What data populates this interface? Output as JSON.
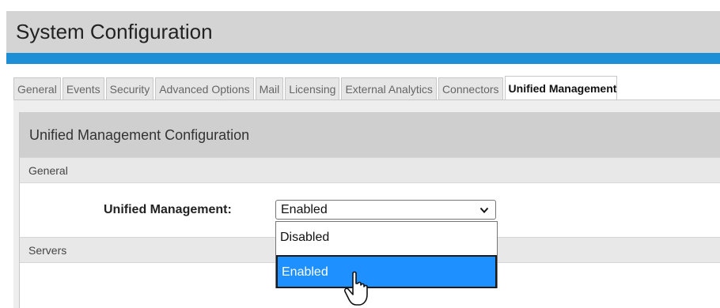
{
  "page": {
    "title": "System Configuration"
  },
  "tabs": [
    "General",
    "Events",
    "Security",
    "Advanced Options",
    "Mail",
    "Licensing",
    "External Analytics",
    "Connectors",
    "Unified Management"
  ],
  "active_tab": "Unified Management",
  "panel": {
    "title": "Unified Management Configuration"
  },
  "sections": {
    "general": "General",
    "servers": "Servers"
  },
  "field": {
    "label": "Unified Management:",
    "value": "Enabled",
    "options": [
      "Disabled",
      "Enabled"
    ],
    "highlighted_option": "Enabled"
  },
  "colors": {
    "accent": "#1c8fd6",
    "highlight": "#1e90ff"
  },
  "icons": {
    "select_arrow": "chevron-down-icon",
    "pointer": "mouse-pointer-icon"
  }
}
